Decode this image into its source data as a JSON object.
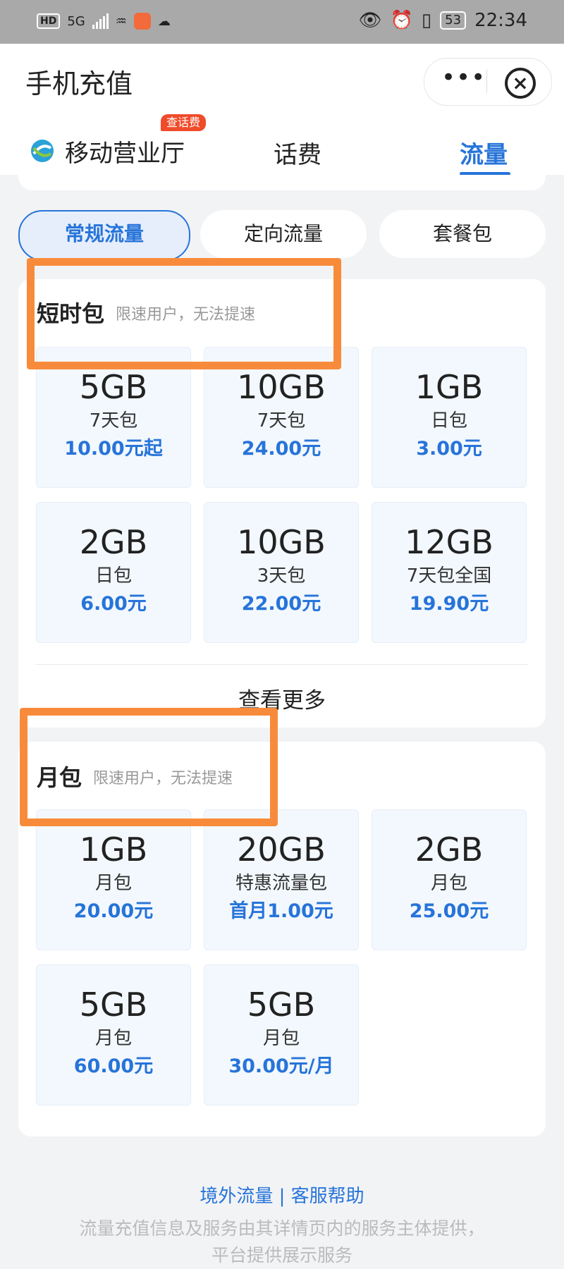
{
  "status_bar": {
    "network": "5G",
    "battery": "53",
    "time": "22:34",
    "icons": [
      "hd-icon",
      "signal-icon",
      "wifi-icon",
      "app-icon",
      "wechat-icon",
      "eye-icon",
      "alarm-icon",
      "vibrate-icon"
    ]
  },
  "header": {
    "title": "手机充值",
    "more_label": "•••",
    "close_label": "×"
  },
  "nav": {
    "brand": "移动营业厅",
    "badge": "查话费",
    "tabs": [
      {
        "label": "话费",
        "active": false
      },
      {
        "label": "流量",
        "active": true
      }
    ]
  },
  "filters": [
    {
      "label": "常规流量",
      "active": true
    },
    {
      "label": "定向流量",
      "active": false
    },
    {
      "label": "套餐包",
      "active": false
    }
  ],
  "short_term": {
    "title": "短时包",
    "subtitle": "限速用户，无法提速",
    "items": [
      {
        "size": "5GB",
        "desc": "7天包",
        "price": "10.00元起"
      },
      {
        "size": "10GB",
        "desc": "7天包",
        "price": "24.00元"
      },
      {
        "size": "1GB",
        "desc": "日包",
        "price": "3.00元"
      },
      {
        "size": "2GB",
        "desc": "日包",
        "price": "6.00元"
      },
      {
        "size": "10GB",
        "desc": "3天包",
        "price": "22.00元"
      },
      {
        "size": "12GB",
        "desc": "7天包全国",
        "price": "19.90元"
      }
    ],
    "see_more": "查看更多"
  },
  "monthly": {
    "title": "月包",
    "subtitle": "限速用户，无法提速",
    "items": [
      {
        "size": "1GB",
        "desc": "月包",
        "price": "20.00元"
      },
      {
        "size": "20GB",
        "desc": "特惠流量包",
        "price": "首月1.00元"
      },
      {
        "size": "2GB",
        "desc": "月包",
        "price": "25.00元"
      },
      {
        "size": "5GB",
        "desc": "月包",
        "price": "60.00元"
      },
      {
        "size": "5GB",
        "desc": "月包",
        "price": "30.00元/月"
      }
    ]
  },
  "footer": {
    "link_roaming": "境外流量",
    "separator": "|",
    "link_help": "客服帮助",
    "note_line1": "流量充值信息及服务由其详情页内的服务主体提供，",
    "note_line2": "平台提供展示服务"
  },
  "colors": {
    "accent": "#2774d9",
    "highlight": "#f88b3b",
    "badge": "#f04b2a"
  }
}
